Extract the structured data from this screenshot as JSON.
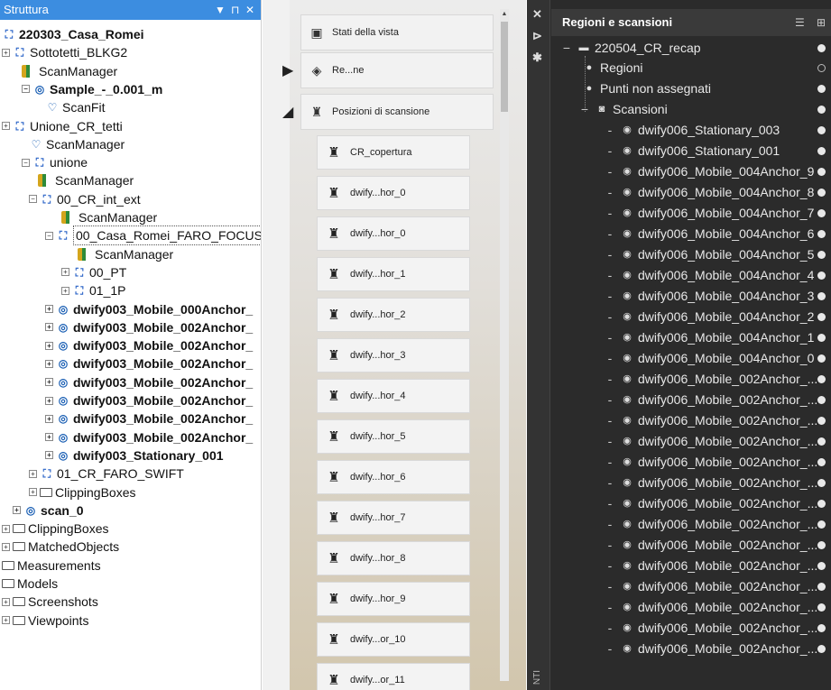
{
  "structure": {
    "title": "Struttura",
    "controls": [
      "▼",
      "⊓",
      "✕"
    ],
    "items": [
      {
        "label": "220303_Casa_Romei",
        "icon": "cluster-icon",
        "bold": true
      },
      {
        "label": "Sottotetti_BLKG2",
        "icon": "cluster-icon"
      },
      {
        "label": "ScanManager",
        "icon": "scanmanager-icon"
      },
      {
        "label": "Sample_-_0.001_m",
        "icon": "scan-icon",
        "bold": true
      },
      {
        "label": "ScanFit",
        "icon": "scanfit-icon"
      },
      {
        "label": "Unione_CR_tetti",
        "icon": "cluster-icon"
      },
      {
        "label": "ScanManager",
        "icon": "scanfit-icon"
      },
      {
        "label": "unione",
        "icon": "cluster-icon"
      },
      {
        "label": "ScanManager",
        "icon": "scanmanager-icon"
      },
      {
        "label": "00_CR_int_ext",
        "icon": "cluster-icon"
      },
      {
        "label": "ScanManager",
        "icon": "scanmanager-icon"
      },
      {
        "label": "00_Casa_Romei_FARO_FOCUS",
        "icon": "cluster-icon"
      },
      {
        "label": "ScanManager",
        "icon": "scanmanager-icon"
      },
      {
        "label": "00_PT",
        "icon": "cluster-icon"
      },
      {
        "label": "01_1P",
        "icon": "cluster-icon"
      },
      {
        "label": "dwify003_Mobile_000Anchor_",
        "icon": "scan-icon",
        "bold": true
      },
      {
        "label": "dwify003_Mobile_002Anchor_",
        "icon": "scan-icon",
        "bold": true
      },
      {
        "label": "dwify003_Mobile_002Anchor_",
        "icon": "scan-icon",
        "bold": true
      },
      {
        "label": "dwify003_Mobile_002Anchor_",
        "icon": "scan-icon",
        "bold": true
      },
      {
        "label": "dwify003_Mobile_002Anchor_",
        "icon": "scan-icon",
        "bold": true
      },
      {
        "label": "dwify003_Mobile_002Anchor_",
        "icon": "scan-icon",
        "bold": true
      },
      {
        "label": "dwify003_Mobile_002Anchor_",
        "icon": "scan-icon",
        "bold": true
      },
      {
        "label": "dwify003_Mobile_002Anchor_",
        "icon": "scan-icon",
        "bold": true
      },
      {
        "label": "dwify003_Stationary_001",
        "icon": "scan-icon",
        "bold": true
      },
      {
        "label": "01_CR_FARO_SWIFT",
        "icon": "cluster-icon"
      },
      {
        "label": "ClippingBoxes",
        "icon": "folder-icon"
      },
      {
        "label": "scan_0",
        "icon": "scan-icon",
        "bold": true
      },
      {
        "label": "ClippingBoxes",
        "icon": "folder-icon"
      },
      {
        "label": "MatchedObjects",
        "icon": "folder-icon"
      },
      {
        "label": "Measurements",
        "icon": "folder-icon"
      },
      {
        "label": "Models",
        "icon": "folder-icon"
      },
      {
        "label": "Screenshots",
        "icon": "folder-icon"
      },
      {
        "label": "Viewpoints",
        "icon": "folder-icon"
      }
    ]
  },
  "middle": {
    "headers": [
      {
        "label": "Stati della vista",
        "icon": "image-icon"
      },
      {
        "label": "Re...ne",
        "icon": "layers-icon"
      },
      {
        "label": "Posizioni di scansione",
        "icon": "scanner-icon"
      }
    ],
    "items": [
      "CR_copertura",
      "dwify...hor_0",
      "dwify...hor_0",
      "dwify...hor_1",
      "dwify...hor_2",
      "dwify...hor_3",
      "dwify...hor_4",
      "dwify...hor_5",
      "dwify...hor_6",
      "dwify...hor_7",
      "dwify...hor_8",
      "dwify...hor_9",
      "dwify...or_10",
      "dwify...or_11"
    ]
  },
  "regions": {
    "title": "Regioni e scansioni",
    "side_label": "NTI",
    "root": "220504_CR_recap",
    "groups": [
      "Regioni",
      "Punti non assegnati",
      "Scansioni"
    ],
    "scans": [
      "dwify006_Stationary_003",
      "dwify006_Stationary_001",
      "dwify006_Mobile_004Anchor_9",
      "dwify006_Mobile_004Anchor_8",
      "dwify006_Mobile_004Anchor_7",
      "dwify006_Mobile_004Anchor_6",
      "dwify006_Mobile_004Anchor_5",
      "dwify006_Mobile_004Anchor_4",
      "dwify006_Mobile_004Anchor_3",
      "dwify006_Mobile_004Anchor_2",
      "dwify006_Mobile_004Anchor_1",
      "dwify006_Mobile_004Anchor_0",
      "dwify006_Mobile_002Anchor_...",
      "dwify006_Mobile_002Anchor_...",
      "dwify006_Mobile_002Anchor_...",
      "dwify006_Mobile_002Anchor_...",
      "dwify006_Mobile_002Anchor_...",
      "dwify006_Mobile_002Anchor_...",
      "dwify006_Mobile_002Anchor_...",
      "dwify006_Mobile_002Anchor_...",
      "dwify006_Mobile_002Anchor_...",
      "dwify006_Mobile_002Anchor_...",
      "dwify006_Mobile_002Anchor_...",
      "dwify006_Mobile_002Anchor_...",
      "dwify006_Mobile_002Anchor_...",
      "dwify006_Mobile_002Anchor_..."
    ]
  },
  "colors": {
    "accent": "#3c8de0",
    "dark_panel": "#2b2b2b"
  }
}
